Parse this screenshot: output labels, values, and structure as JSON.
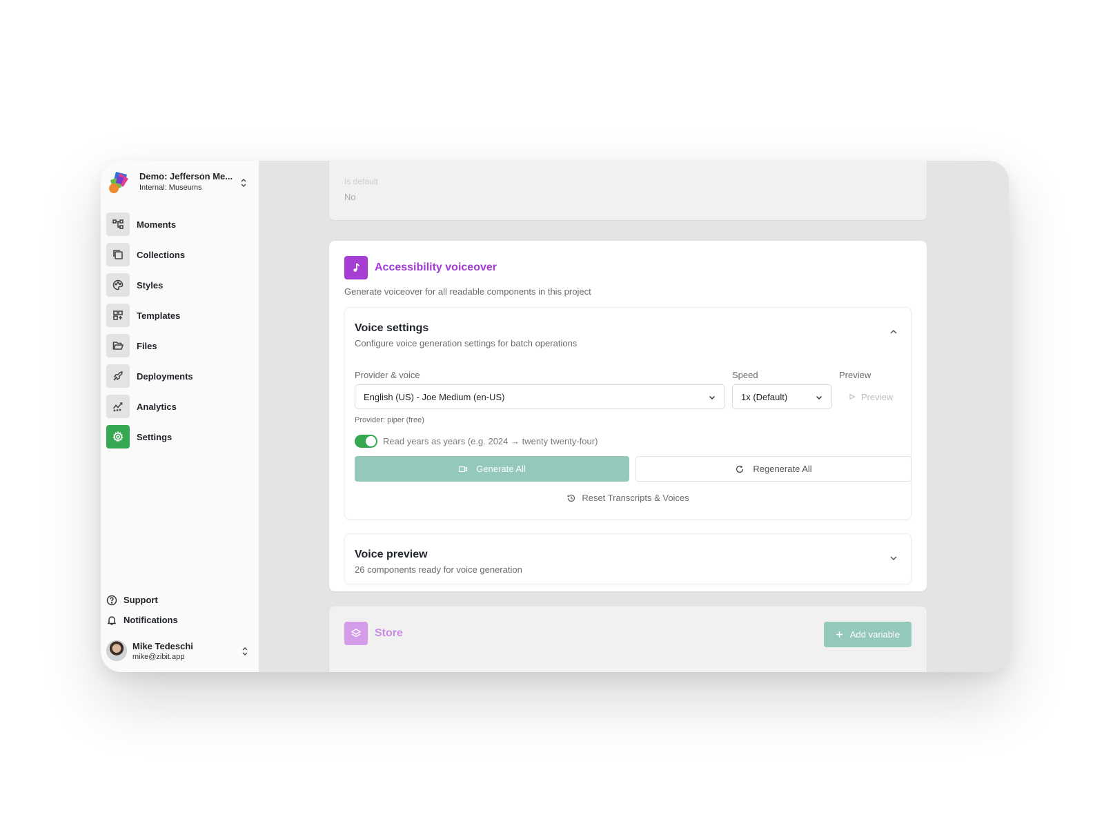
{
  "workspace": {
    "name": "Demo: Jefferson Me...",
    "subtitle": "Internal: Museums"
  },
  "sidebar": {
    "items": [
      {
        "label": "Moments",
        "icon": "moments-icon"
      },
      {
        "label": "Collections",
        "icon": "collections-icon"
      },
      {
        "label": "Styles",
        "icon": "palette-icon"
      },
      {
        "label": "Templates",
        "icon": "templates-icon"
      },
      {
        "label": "Files",
        "icon": "folder-icon"
      },
      {
        "label": "Deployments",
        "icon": "rocket-icon"
      },
      {
        "label": "Analytics",
        "icon": "analytics-icon"
      },
      {
        "label": "Settings",
        "icon": "gear-icon",
        "active": true
      }
    ],
    "support_label": "Support",
    "notifications_label": "Notifications"
  },
  "user": {
    "name": "Mike Tedeschi",
    "email": "mike@zibit.app"
  },
  "default_card": {
    "label": "Is default",
    "value": "No"
  },
  "voiceover": {
    "title": "Accessibility voiceover",
    "description": "Generate voiceover for all readable components in this project",
    "settings": {
      "title": "Voice settings",
      "subtitle": "Configure voice generation settings for batch operations",
      "provider_label": "Provider & voice",
      "provider_value": "English (US) - Joe Medium (en-US)",
      "speed_label": "Speed",
      "speed_value": "1x (Default)",
      "preview_label": "Preview",
      "preview_button": "Preview",
      "provider_note": "Provider: piper (free)",
      "toggle_label": "Read years as years (e.g. 2024 → twenty twenty-four)",
      "toggle_on": true,
      "generate_button": "Generate All",
      "regenerate_button": "Regenerate All",
      "reset_button": "Reset Transcripts & Voices"
    },
    "preview": {
      "title": "Voice preview",
      "subtitle": "26 components ready for voice generation"
    }
  },
  "store": {
    "title": "Store",
    "add_button": "Add variable"
  },
  "colors": {
    "accent_green": "#36a852",
    "muted_teal": "#93c8ba",
    "purple": "#a63ed4",
    "store_purple": "#d49ce9"
  }
}
